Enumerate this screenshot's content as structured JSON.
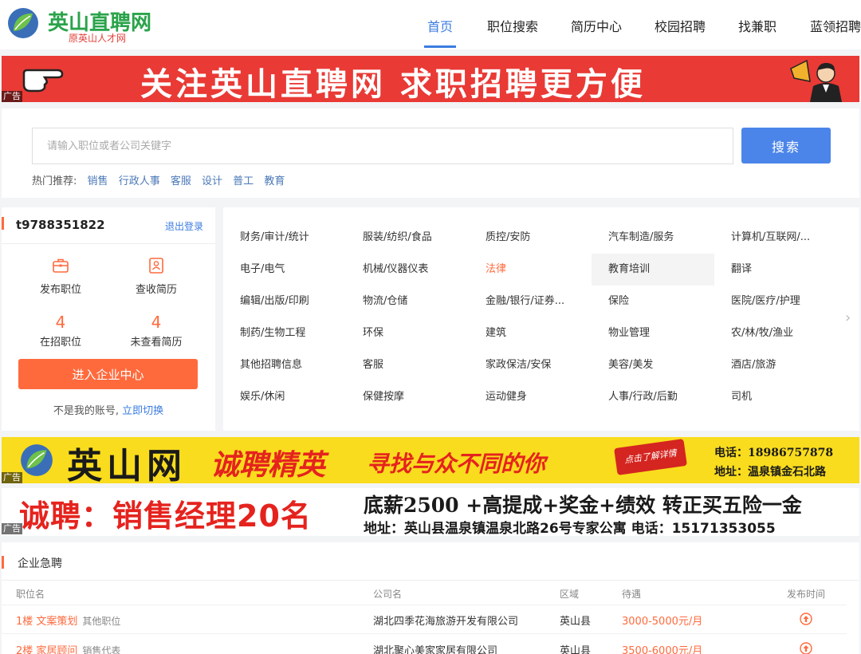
{
  "header": {
    "logo_title": "英山直聘网",
    "logo_sub": "原英山人才网",
    "nav": [
      "首页",
      "职位搜索",
      "简历中心",
      "校园招聘",
      "找兼职",
      "蓝领招聘"
    ]
  },
  "banner1": {
    "text": "关注英山直聘网  求职招聘更方便",
    "ad": "广告"
  },
  "search": {
    "placeholder": "请输入职位或者公司关键字",
    "button": "搜索",
    "hot_label": "热门推荐:",
    "hot": [
      "销售",
      "行政人事",
      "客服",
      "设计",
      "普工",
      "教育"
    ]
  },
  "user": {
    "name": "t9788351822",
    "logout": "退出登录",
    "actions": [
      "发布职位",
      "查收简历"
    ],
    "stats": [
      {
        "num": "4",
        "label": "在招职位"
      },
      {
        "num": "4",
        "label": "未查看简历"
      }
    ],
    "enter_button": "进入企业中心",
    "switch_text": "不是我的账号,",
    "switch_link": "立即切换"
  },
  "categories": [
    [
      "财务/审计/统计",
      "服装/纺织/食品",
      "质控/安防",
      "汽车制造/服务",
      "计算机/互联网/..."
    ],
    [
      "电子/电气",
      "机械/仪器仪表",
      "法律",
      "教育培训",
      "翻译"
    ],
    [
      "编辑/出版/印刷",
      "物流/仓储",
      "金融/银行/证券...",
      "保险",
      "医院/医疗/护理"
    ],
    [
      "制药/生物工程",
      "环保",
      "建筑",
      "物业管理",
      "农/林/牧/渔业"
    ],
    [
      "其他招聘信息",
      "客服",
      "家政保洁/安保",
      "美容/美发",
      "酒店/旅游"
    ],
    [
      "娱乐/休闲",
      "保健按摩",
      "运动健身",
      "人事/行政/后勤",
      "司机"
    ]
  ],
  "banner2": {
    "name": "英山网",
    "slogan1": "诚聘精英",
    "slogan2": "寻找与众不同的你",
    "click": "点击了解详情",
    "phone": "电话：18986757878",
    "address": "地址：温泉镇金石北路",
    "ad": "广告"
  },
  "banner3": {
    "title": "诚聘：销售经理20名",
    "line1": "底薪2500 +高提成+奖金+绩效 转正买五险一金",
    "line2": "地址：英山县温泉镇温泉北路26号专家公寓 电话：15171353055",
    "ad": "广告"
  },
  "jobs": {
    "title": "企业急聘",
    "headers": [
      "职位名",
      "公司名",
      "区域",
      "待遇",
      "发布时间"
    ],
    "rows": [
      {
        "title": "1楼 文案策划",
        "category": "其他职位",
        "company": "湖北四季花海旅游开发有限公司",
        "area": "英山县",
        "salary": "3000-5000元/月"
      },
      {
        "title": "2楼 家居顾问",
        "category": "销售代表",
        "company": "湖北聚心美家家居有限公司",
        "area": "英山县",
        "salary": "3500-6000元/月"
      }
    ]
  },
  "colors": {
    "brand_blue": "#4b85e9",
    "accent_orange": "#ff6a3d",
    "logo_green": "#2aa34a",
    "banner_red": "#e93a35",
    "banner_yellow": "#f9dc1d"
  }
}
